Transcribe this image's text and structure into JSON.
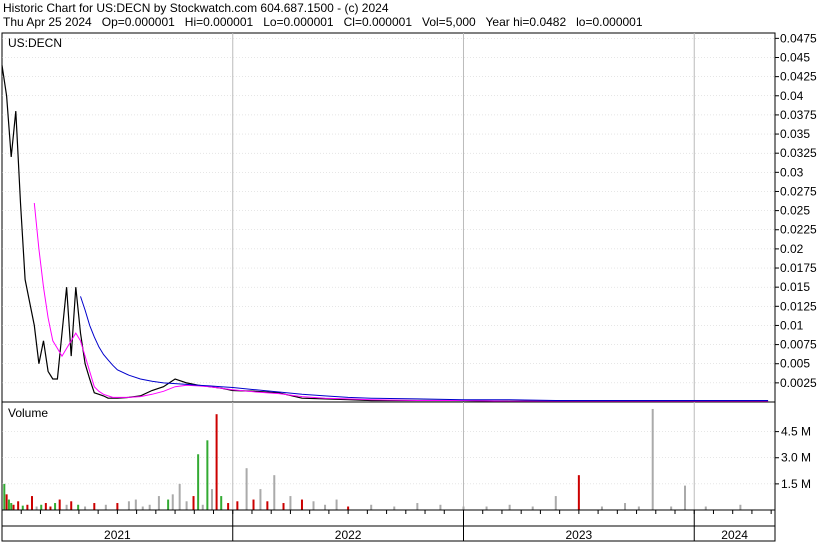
{
  "header": {
    "line1": "Historic Chart for US:DECN by Stockwatch.com 604.687.1500 - (c) 2024",
    "line2": "Thu Apr 25 2024   Op=0.000001   Hi=0.000001   Lo=0.000001   Cl=0.000001   Vol=5,000   Year hi=0.0482   lo=0.000001"
  },
  "colors": {
    "price": "#000000",
    "ma_short": "#ff00ff",
    "ma_long": "#0000cc",
    "up_volume": "#33aa33",
    "down_volume": "#cc0000",
    "neutral_volume": "#aaaaaa",
    "grid": "#cccccc"
  },
  "chart_data": [
    {
      "type": "line",
      "title": "US:DECN",
      "ylim": [
        0,
        0.0482
      ],
      "y_ticks": [
        "0.0025",
        "0.005",
        "0.0075",
        "0.01",
        "0.0125",
        "0.015",
        "0.0175",
        "0.02",
        "0.0225",
        "0.025",
        "0.0275",
        "0.03",
        "0.0325",
        "0.035",
        "0.0375",
        "0.04",
        "0.0425",
        "0.045",
        "0.0475"
      ],
      "x_ticks": [
        "2021",
        "2022",
        "2023",
        "2024"
      ],
      "x": [
        2021.0,
        2021.02,
        2021.04,
        2021.06,
        2021.08,
        2021.1,
        2021.12,
        2021.14,
        2021.16,
        2021.18,
        2021.2,
        2021.22,
        2021.24,
        2021.26,
        2021.28,
        2021.3,
        2021.32,
        2021.34,
        2021.36,
        2021.38,
        2021.4,
        2021.42,
        2021.44,
        2021.46,
        2021.48,
        2021.5,
        2021.55,
        2021.6,
        2021.65,
        2021.7,
        2021.75,
        2021.8,
        2021.85,
        2021.9,
        2021.95,
        2022.0,
        2022.1,
        2022.2,
        2022.3,
        2022.4,
        2022.5,
        2022.6,
        2022.8,
        2023.0,
        2023.2,
        2023.4,
        2023.6,
        2023.8,
        2024.0,
        2024.32
      ],
      "series": [
        {
          "values": [
            0.044,
            0.04,
            0.032,
            0.038,
            0.026,
            0.016,
            0.013,
            0.01,
            0.005,
            0.008,
            0.004,
            0.003,
            0.003,
            0.009,
            0.015,
            0.006,
            0.015,
            0.009,
            0.005,
            0.003,
            0.0012,
            0.001,
            0.0008,
            0.0005,
            0.0005,
            0.0005,
            0.0006,
            0.0008,
            0.0015,
            0.002,
            0.003,
            0.0025,
            0.0022,
            0.002,
            0.0018,
            0.0015,
            0.0014,
            0.0012,
            0.0005,
            0.0004,
            0.0003,
            0.0002,
            0.0002,
            0.0002,
            0.0001,
            0.0001,
            0.0001,
            0.0001,
            0.0001,
            1e-06
          ]
        },
        {
          "values": [
            null,
            null,
            null,
            null,
            null,
            null,
            null,
            0.026,
            0.02,
            0.015,
            0.011,
            0.008,
            0.007,
            0.006,
            0.007,
            0.008,
            0.009,
            0.008,
            0.006,
            0.004,
            0.002,
            0.0014,
            0.001,
            0.0008,
            0.0006,
            0.0006,
            0.0006,
            0.0007,
            0.001,
            0.0014,
            0.002,
            0.0022,
            0.0021,
            0.002,
            0.0018,
            0.0016,
            0.0013,
            0.0011,
            0.0007,
            0.0005,
            0.0004,
            0.0003,
            0.0002,
            0.0002,
            0.0001,
            0.0001,
            0.0001,
            0.0001,
            0.0001,
            0.0001
          ]
        },
        {
          "values": [
            null,
            null,
            null,
            null,
            null,
            null,
            null,
            null,
            null,
            null,
            null,
            null,
            null,
            null,
            null,
            null,
            null,
            0.0138,
            0.012,
            0.01,
            0.0085,
            0.0072,
            0.0062,
            0.0055,
            0.0048,
            0.0042,
            0.0035,
            0.003,
            0.0027,
            0.0025,
            0.0024,
            0.0023,
            0.0022,
            0.0021,
            0.002,
            0.0019,
            0.0016,
            0.0013,
            0.001,
            0.0008,
            0.0006,
            0.0005,
            0.0004,
            0.0003,
            0.0003,
            0.0002,
            0.0002,
            0.0002,
            0.0002,
            0.0002
          ]
        }
      ]
    },
    {
      "type": "bar",
      "title": "Volume",
      "ylim": [
        0,
        6.2
      ],
      "y_ticks": [
        "1.5 M",
        "3.0 M",
        "4.5 M"
      ],
      "x_ticks": [
        "2021",
        "2022",
        "2023",
        "2024"
      ],
      "series": [
        {
          "name": "",
          "values": [
            {
              "x": 2021.01,
              "v": 1.5,
              "c": "g"
            },
            {
              "x": 2021.02,
              "v": 0.9,
              "c": "r"
            },
            {
              "x": 2021.03,
              "v": 0.6,
              "c": "g"
            },
            {
              "x": 2021.04,
              "v": 0.4,
              "c": "g"
            },
            {
              "x": 2021.05,
              "v": 0.3,
              "c": "r"
            },
            {
              "x": 2021.07,
              "v": 0.5,
              "c": "r"
            },
            {
              "x": 2021.09,
              "v": 0.25,
              "c": "g"
            },
            {
              "x": 2021.11,
              "v": 0.3,
              "c": "r"
            },
            {
              "x": 2021.13,
              "v": 0.8,
              "c": "r"
            },
            {
              "x": 2021.15,
              "v": 0.2,
              "c": "n"
            },
            {
              "x": 2021.17,
              "v": 0.3,
              "c": "g"
            },
            {
              "x": 2021.19,
              "v": 0.4,
              "c": "r"
            },
            {
              "x": 2021.21,
              "v": 0.2,
              "c": "r"
            },
            {
              "x": 2021.23,
              "v": 0.4,
              "c": "g"
            },
            {
              "x": 2021.25,
              "v": 0.6,
              "c": "r"
            },
            {
              "x": 2021.28,
              "v": 0.3,
              "c": "n"
            },
            {
              "x": 2021.3,
              "v": 0.5,
              "c": "r"
            },
            {
              "x": 2021.33,
              "v": 0.3,
              "c": "g"
            },
            {
              "x": 2021.36,
              "v": 0.2,
              "c": "n"
            },
            {
              "x": 2021.4,
              "v": 0.4,
              "c": "r"
            },
            {
              "x": 2021.45,
              "v": 0.3,
              "c": "n"
            },
            {
              "x": 2021.5,
              "v": 0.4,
              "c": "r"
            },
            {
              "x": 2021.55,
              "v": 0.5,
              "c": "n"
            },
            {
              "x": 2021.58,
              "v": 0.6,
              "c": "n"
            },
            {
              "x": 2021.61,
              "v": 0.2,
              "c": "n"
            },
            {
              "x": 2021.64,
              "v": 0.3,
              "c": "n"
            },
            {
              "x": 2021.68,
              "v": 0.8,
              "c": "n"
            },
            {
              "x": 2021.72,
              "v": 0.6,
              "c": "g"
            },
            {
              "x": 2021.74,
              "v": 0.9,
              "c": "n"
            },
            {
              "x": 2021.77,
              "v": 1.5,
              "c": "n"
            },
            {
              "x": 2021.8,
              "v": 0.5,
              "c": "n"
            },
            {
              "x": 2021.83,
              "v": 0.8,
              "c": "r"
            },
            {
              "x": 2021.85,
              "v": 3.2,
              "c": "g"
            },
            {
              "x": 2021.87,
              "v": 0.3,
              "c": "n"
            },
            {
              "x": 2021.89,
              "v": 4.0,
              "c": "g"
            },
            {
              "x": 2021.91,
              "v": 1.2,
              "c": "n"
            },
            {
              "x": 2021.93,
              "v": 5.5,
              "c": "r"
            },
            {
              "x": 2021.95,
              "v": 0.8,
              "c": "g"
            },
            {
              "x": 2021.98,
              "v": 0.4,
              "c": "r"
            },
            {
              "x": 2022.02,
              "v": 0.5,
              "c": "r"
            },
            {
              "x": 2022.06,
              "v": 2.4,
              "c": "n"
            },
            {
              "x": 2022.09,
              "v": 0.6,
              "c": "r"
            },
            {
              "x": 2022.12,
              "v": 1.2,
              "c": "n"
            },
            {
              "x": 2022.15,
              "v": 0.5,
              "c": "r"
            },
            {
              "x": 2022.18,
              "v": 2.0,
              "c": "n"
            },
            {
              "x": 2022.22,
              "v": 0.4,
              "c": "r"
            },
            {
              "x": 2022.25,
              "v": 0.8,
              "c": "n"
            },
            {
              "x": 2022.3,
              "v": 0.6,
              "c": "r"
            },
            {
              "x": 2022.35,
              "v": 0.5,
              "c": "n"
            },
            {
              "x": 2022.4,
              "v": 0.3,
              "c": "n"
            },
            {
              "x": 2022.45,
              "v": 0.6,
              "c": "n"
            },
            {
              "x": 2022.5,
              "v": 0.2,
              "c": "r"
            },
            {
              "x": 2022.6,
              "v": 0.3,
              "c": "n"
            },
            {
              "x": 2022.7,
              "v": 0.2,
              "c": "n"
            },
            {
              "x": 2022.8,
              "v": 0.4,
              "c": "n"
            },
            {
              "x": 2022.9,
              "v": 0.3,
              "c": "n"
            },
            {
              "x": 2023.0,
              "v": 0.2,
              "c": "n"
            },
            {
              "x": 2023.1,
              "v": 0.2,
              "c": "n"
            },
            {
              "x": 2023.2,
              "v": 0.3,
              "c": "n"
            },
            {
              "x": 2023.3,
              "v": 0.2,
              "c": "n"
            },
            {
              "x": 2023.4,
              "v": 0.8,
              "c": "n"
            },
            {
              "x": 2023.5,
              "v": 2.0,
              "c": "r"
            },
            {
              "x": 2023.6,
              "v": 0.2,
              "c": "n"
            },
            {
              "x": 2023.7,
              "v": 0.4,
              "c": "n"
            },
            {
              "x": 2023.76,
              "v": 0.2,
              "c": "n"
            },
            {
              "x": 2023.82,
              "v": 5.8,
              "c": "n"
            },
            {
              "x": 2023.9,
              "v": 0.2,
              "c": "n"
            },
            {
              "x": 2023.96,
              "v": 1.4,
              "c": "n"
            },
            {
              "x": 2024.05,
              "v": 0.2,
              "c": "n"
            },
            {
              "x": 2024.2,
              "v": 0.3,
              "c": "n"
            }
          ]
        }
      ]
    }
  ]
}
